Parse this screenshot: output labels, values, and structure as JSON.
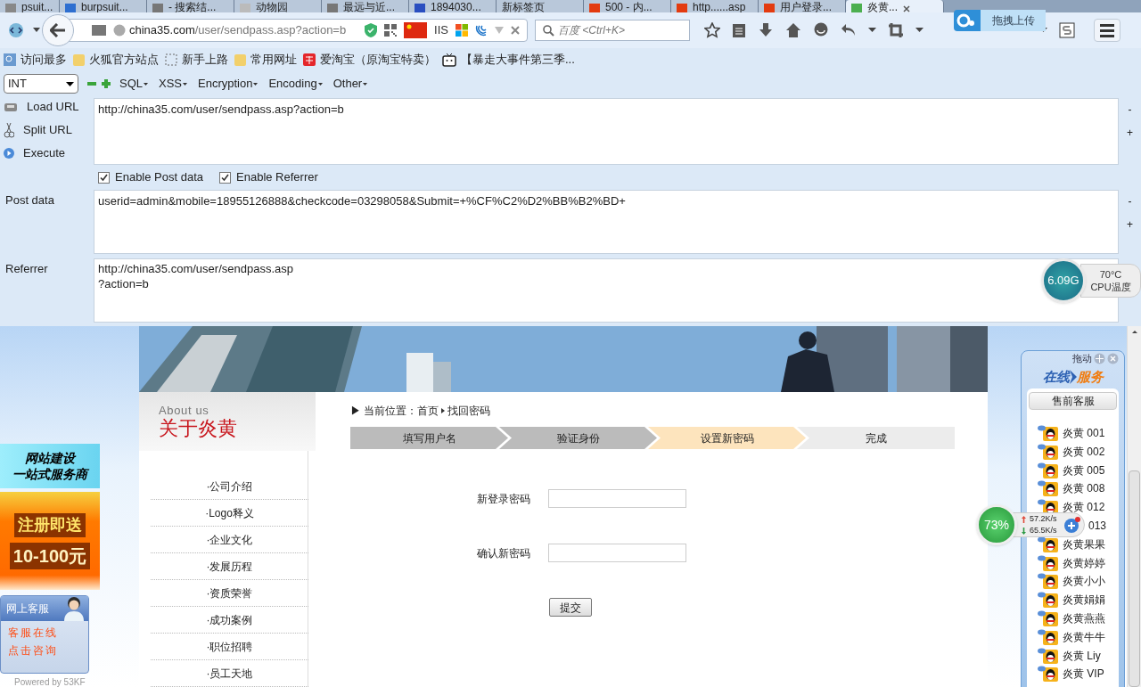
{
  "tabs": [
    {
      "title": "psuit...",
      "selected": false
    },
    {
      "title": "burpsuit...",
      "selected": false
    },
    {
      "title": "- 搜索结...",
      "selected": false
    },
    {
      "title": "动物园",
      "selected": false
    },
    {
      "title": "最远与近...",
      "selected": false
    },
    {
      "title": "1894030...",
      "selected": false
    },
    {
      "title": "新标签页",
      "selected": false
    },
    {
      "title": "500 - 内...",
      "selected": false
    },
    {
      "title": "http......asp",
      "selected": false
    },
    {
      "title": "用户登录...",
      "selected": false
    },
    {
      "title": "炎黄...",
      "selected": true
    }
  ],
  "toolbar": {
    "url_host": "china35.com",
    "url_path": "/user/sendpass.asp?action=b",
    "url_badge": "IIS",
    "search_placeholder": "百度 <Ctrl+K>"
  },
  "upload_popup": "拖拽上传",
  "bookmarks": [
    "访问最多",
    "火狐官方站点",
    "新手上路",
    "常用网址",
    "爱淘宝（原淘宝特卖）",
    "【暴走大事件第三季..."
  ],
  "hackbar": {
    "select": "INT",
    "menus": [
      "SQL",
      "XSS",
      "Encryption",
      "Encoding",
      "Other"
    ],
    "actions": [
      "Load URL",
      "Split URL",
      "Execute"
    ],
    "url": "http://china35.com/user/sendpass.asp?action=b",
    "options": [
      {
        "label": "Enable Post data",
        "checked": true
      },
      {
        "label": "Enable Referrer",
        "checked": true
      }
    ],
    "post_label": "Post data",
    "post_data": "userid=admin&mobile=18955126888&checkcode=03298058&Submit=+%CF%C2%D2%BB%B2%BD+",
    "referrer_label": "Referrer",
    "referrer": [
      "http://china35.com/user/sendpass.asp",
      "?action=b"
    ],
    "size_buttons": [
      "-",
      "+",
      "-",
      "+"
    ]
  },
  "site": {
    "sidebar_en": "About us",
    "sidebar_title": "关于炎黄",
    "menu": [
      "·公司介绍",
      "·Logo释义",
      "·企业文化",
      "·发展历程",
      "·资质荣誉",
      "·成功案例",
      "·职位招聘",
      "·员工天地"
    ],
    "breadcrumb": [
      "▶ 当前位置：首页",
      "找回密码"
    ],
    "steps": [
      {
        "label": "填写用户名",
        "completed": true,
        "selected": false
      },
      {
        "label": "验证身份",
        "completed": true,
        "selected": false
      },
      {
        "label": "设置新密码",
        "completed": false,
        "selected": true
      },
      {
        "label": "完成",
        "completed": false,
        "selected": false
      }
    ],
    "fields": [
      {
        "label": "新登录密码"
      },
      {
        "label": "确认新密码"
      }
    ],
    "submit": "提交"
  },
  "ads": [
    {
      "lines": [
        "网站建设",
        "一站式服务商"
      ]
    },
    {
      "lines": [
        "注册即送",
        "10-100元"
      ]
    }
  ],
  "kefu": {
    "title": "网上客服",
    "lines": [
      "客服在线",
      "点击咨询"
    ],
    "powered": "Powered by 53KF"
  },
  "service": {
    "drag": "拖动",
    "title_a": "在线",
    "title_b": "服务",
    "group": "售前客服",
    "contacts": [
      {
        "name": "炎黄 001",
        "kind": "full"
      },
      {
        "name": "炎黄 002",
        "kind": "full"
      },
      {
        "name": "炎黄 005",
        "kind": "full"
      },
      {
        "name": "炎黄 008",
        "kind": "full"
      },
      {
        "name": "炎黄 012",
        "kind": "full"
      },
      {
        "name": "013",
        "kind": "partial"
      },
      {
        "name": "炎黄果果",
        "kind": "full"
      },
      {
        "name": "炎黄婷婷",
        "kind": "full"
      },
      {
        "name": "炎黄小小",
        "kind": "full"
      },
      {
        "name": "炎黄娟娟",
        "kind": "full"
      },
      {
        "name": "炎黄燕燕",
        "kind": "full"
      },
      {
        "name": "炎黄牛牛",
        "kind": "full"
      },
      {
        "name": "炎黄 Liy",
        "kind": "full"
      },
      {
        "name": "炎黄 VIP",
        "kind": "full"
      }
    ]
  },
  "cpu": {
    "freq": "6.09G",
    "temp": "70°C",
    "label": "CPU温度"
  },
  "net": {
    "percent": "73%",
    "up": "57.2K/s",
    "down": "65.5K/s"
  }
}
